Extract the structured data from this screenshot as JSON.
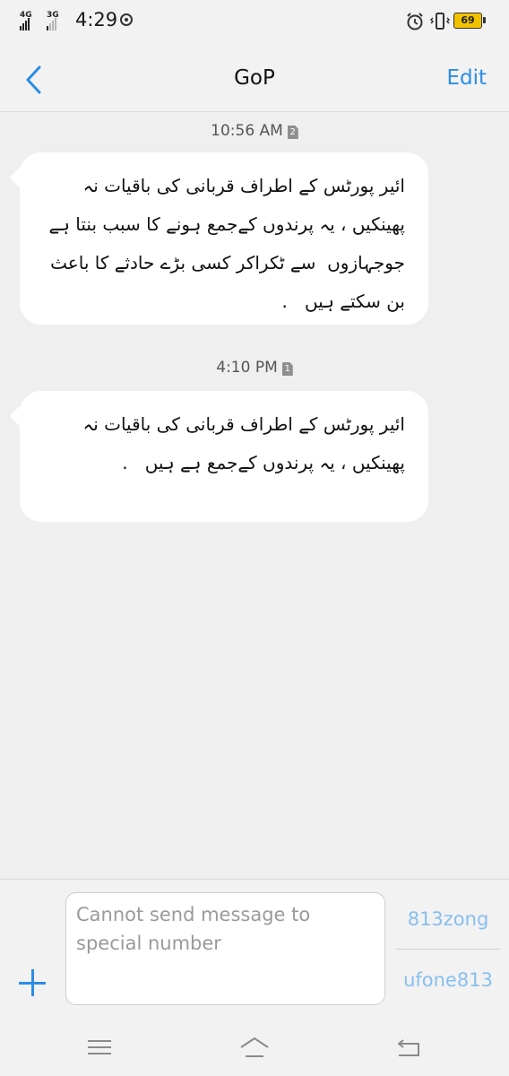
{
  "status_bar": {
    "network_1": "4G",
    "network_2": "3G",
    "time": "4:29",
    "battery": "69",
    "icons": [
      "sync-icon",
      "alarm-icon",
      "vibrate-icon",
      "battery-icon"
    ],
    "battery_color": "#f2c200"
  },
  "nav": {
    "back_icon": "chevron-left-icon",
    "title": "GoP",
    "edit_label": "Edit",
    "accent_color": "#2b8de5"
  },
  "messages": [
    {
      "time": "10:56 AM",
      "sim": "2",
      "text": "ائیر پورٹس کے اطراف قربانی کی باقیات نہ پھینکیں ، یہ پرندوں کےجمع ہونے کا سبب بنتا ہے جوجہازوں  سے ٹکراکر کسی بڑے حادثے کا باعث  بن سکتے ہیں   ."
    },
    {
      "time": "4:10 PM",
      "sim": "1",
      "text": "ائیر پورٹس کے اطراف قربانی کی باقیات نہ پھینکیں ، یہ پرندوں کےجمع ہے ہیں   ."
    }
  ],
  "composer": {
    "add_icon": "plus-icon",
    "placeholder": "Cannot send message to special number",
    "sim_buttons": [
      "813zong",
      "ufone813"
    ]
  },
  "system_nav": {
    "icons": [
      "menu-icon",
      "home-icon",
      "back-icon"
    ]
  }
}
